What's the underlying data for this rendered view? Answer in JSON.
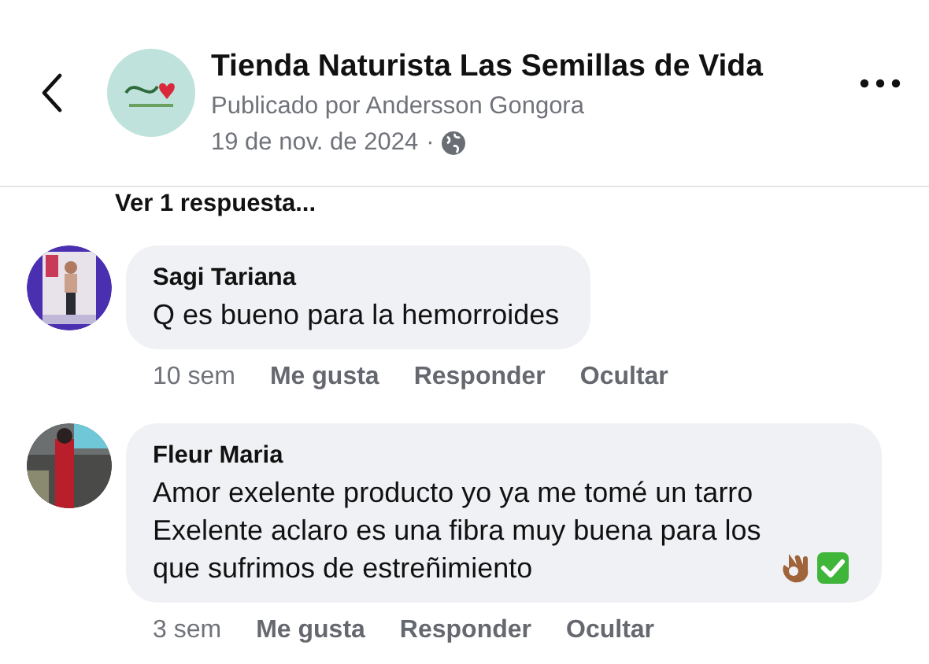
{
  "header": {
    "page_name": "Tienda Naturista Las Semillas de Vida",
    "posted_by": "Publicado por Andersson Gongora",
    "date": "19 de nov. de 2024",
    "separator": "·"
  },
  "view_replies": "Ver 1 respuesta...",
  "comments": [
    {
      "author": "Sagi Tariana",
      "text": "Q es bueno para la hemorroides",
      "time": "10 sem",
      "actions": [
        "Me gusta",
        "Responder",
        "Ocultar"
      ],
      "emoji": false
    },
    {
      "author": "Fleur Maria",
      "text": "Amor exelente producto yo ya me tomé un tarro Exelente aclaro es una fibra muy buena para los que sufrimos de estreñimiento",
      "time": "3 sem",
      "actions": [
        "Me gusta",
        "Responder",
        "Ocultar"
      ],
      "emoji": true
    }
  ]
}
